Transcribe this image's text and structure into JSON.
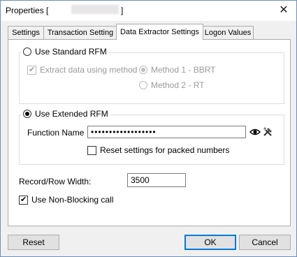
{
  "window": {
    "title": "Properties [",
    "title_suffix": "]",
    "close_glyph": "✕"
  },
  "tabs": [
    {
      "label": "Settings"
    },
    {
      "label": "Transaction Setting"
    },
    {
      "label": "Data Extractor Settings",
      "active": true
    },
    {
      "label": "Logon Values"
    }
  ],
  "standard_rfm": {
    "label": "Use Standard RFM",
    "selected": false,
    "extract_label": "Extract data using method",
    "extract_checked": true,
    "method1_label": "Method 1 - BBRT",
    "method1_selected": true,
    "method2_label": "Method 2 - RT"
  },
  "extended_rfm": {
    "label": "Use Extended RFM",
    "selected": true,
    "function_name_label": "Function Name",
    "function_name_value": "••••••••••••••••••",
    "show_password_icon": "eye-icon",
    "tool_icon": "tools-icon",
    "reset_packed_label": "Reset settings for packed numbers",
    "reset_packed_checked": false
  },
  "record_width": {
    "label": "Record/Row Width:",
    "value": "3500"
  },
  "nonblocking": {
    "label": "Use Non-Blocking call",
    "checked": true
  },
  "buttons": {
    "reset": "Reset",
    "ok": "OK",
    "cancel": "Cancel"
  },
  "colors": {
    "accent": "#0078d7",
    "window_border": "#6e8fb8"
  }
}
